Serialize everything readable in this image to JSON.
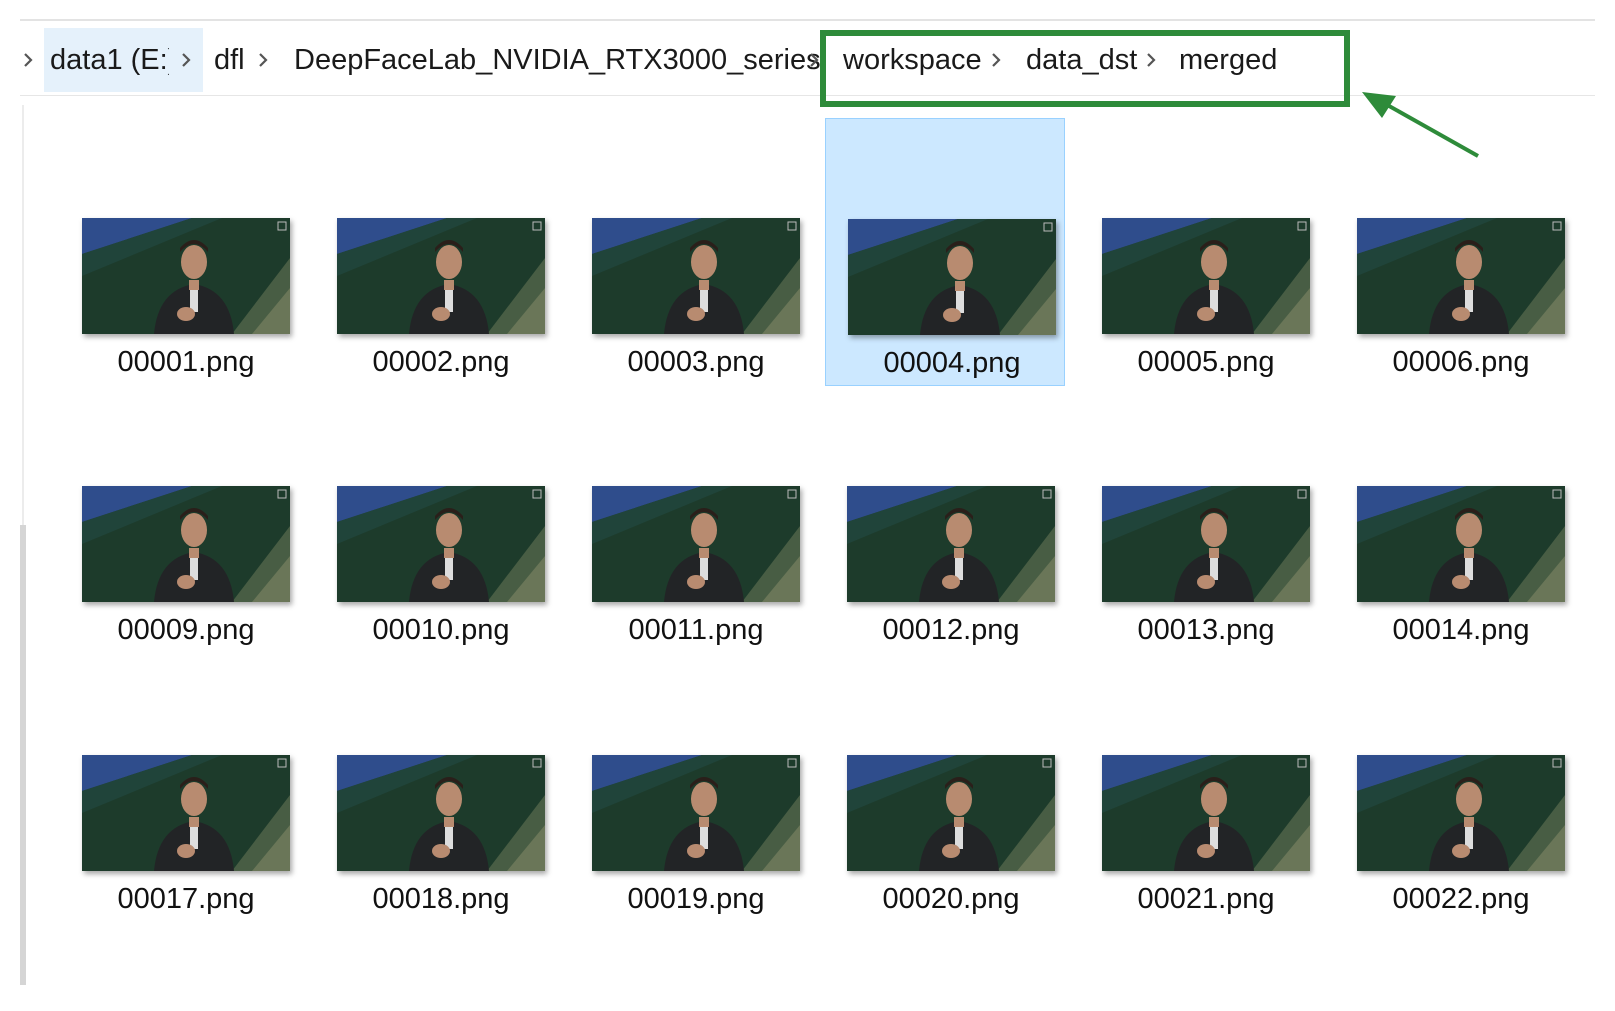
{
  "breadcrumb": {
    "items": [
      {
        "label": "data1 (E:)"
      },
      {
        "label": "dfl"
      },
      {
        "label": "DeepFaceLab_NVIDIA_RTX3000_series"
      },
      {
        "label": "workspace"
      },
      {
        "label": "data_dst"
      },
      {
        "label": "merged"
      }
    ],
    "highlight_color": "#2e8b3a"
  },
  "files": [
    {
      "name": "00001.png"
    },
    {
      "name": "00002.png"
    },
    {
      "name": "00003.png"
    },
    {
      "name": "00004.png",
      "selected": true
    },
    {
      "name": "00005.png"
    },
    {
      "name": "00006.png"
    },
    {
      "name": "00009.png"
    },
    {
      "name": "00010.png"
    },
    {
      "name": "00011.png"
    },
    {
      "name": "00012.png"
    },
    {
      "name": "00013.png"
    },
    {
      "name": "00014.png"
    },
    {
      "name": "00017.png"
    },
    {
      "name": "00018.png"
    },
    {
      "name": "00019.png"
    },
    {
      "name": "00020.png"
    },
    {
      "name": "00021.png"
    },
    {
      "name": "00022.png"
    }
  ],
  "colors": {
    "selection_fill": "#cce8ff",
    "thumb_background": "#1c3a2a",
    "thumb_accent_blue": "#2c4a8a"
  },
  "icons": {
    "separator": "chevron-right-icon",
    "annotation": "arrow-pointer-icon"
  }
}
